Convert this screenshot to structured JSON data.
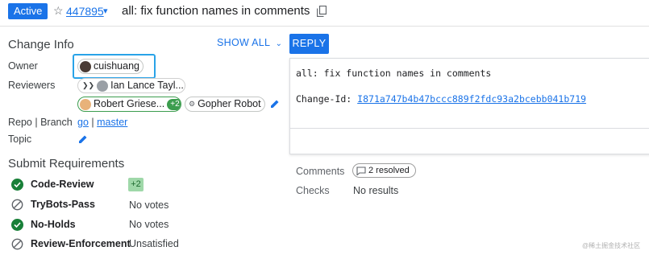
{
  "header": {
    "status": "Active",
    "change_number": "447895",
    "subject": "all: fix function names in comments"
  },
  "change_info": {
    "title": "Change Info",
    "show_all": "SHOW ALL",
    "owner_label": "Owner",
    "owner": "cuishuang",
    "reviewers_label": "Reviewers",
    "reviewers": [
      {
        "name": "Ian Lance Tayl...",
        "vote": ""
      },
      {
        "name": "Robert Griese...",
        "vote": "+2"
      },
      {
        "name": "Gopher Robot",
        "vote": ""
      }
    ],
    "repo_label": "Repo | Branch",
    "repo": "go",
    "separator": "|",
    "branch": "master",
    "topic_label": "Topic"
  },
  "submit_requirements": {
    "title": "Submit Requirements",
    "items": [
      {
        "name": "Code-Review",
        "status": "+2",
        "state": "satisfied"
      },
      {
        "name": "TryBots-Pass",
        "status": "No votes",
        "state": "na"
      },
      {
        "name": "No-Holds",
        "status": "No votes",
        "state": "satisfied"
      },
      {
        "name": "Review-Enforcement",
        "status": "Unsatisfied",
        "state": "na"
      }
    ]
  },
  "reply": {
    "label": "REPLY"
  },
  "commit_message": {
    "line1": "all: fix function names in comments",
    "change_id_label": "Change-Id: ",
    "change_id": "I871a747b4b47bccc889f2fdc93a2bcebb041b719"
  },
  "comments": {
    "label": "Comments",
    "resolved": "2 resolved"
  },
  "checks": {
    "label": "Checks",
    "value": "No results"
  },
  "watermark": "@稀土掘金技术社区",
  "colors": {
    "accent": "#1a73e8",
    "approved": "#188038",
    "highlight": "#29a3e8"
  }
}
